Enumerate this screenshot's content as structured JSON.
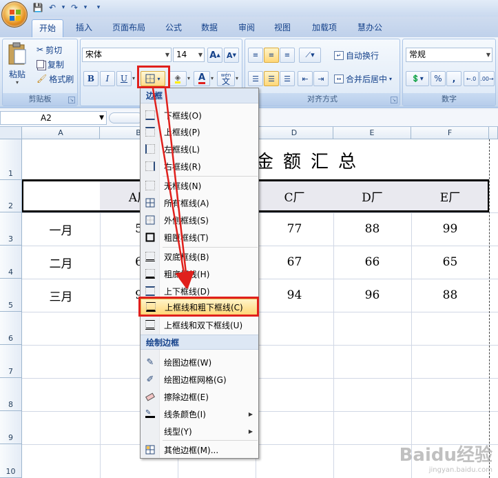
{
  "qat": {
    "save": "💾",
    "undo": "↶",
    "redo": "↷",
    "more": "▾"
  },
  "tabs": [
    "开始",
    "插入",
    "页面布局",
    "公式",
    "数据",
    "审阅",
    "视图",
    "加载项",
    "慧办公"
  ],
  "clipboard": {
    "label": "剪贴板",
    "paste": "粘贴",
    "cut": "剪切",
    "copy": "复制",
    "format_painter": "格式刷"
  },
  "font": {
    "name": "宋体",
    "size": "14",
    "bold": "B",
    "italic": "I",
    "underline": "U",
    "grow": "A",
    "shrink": "A",
    "wen": "wén",
    "wen_char": "文",
    "font_color": "A"
  },
  "alignment": {
    "label": "对齐方式",
    "wrap": "自动换行",
    "merge": "合并后居中"
  },
  "number": {
    "label": "数字",
    "format": "常规",
    "percent": "%",
    "comma": ","
  },
  "formula": {
    "name_box": "A2"
  },
  "columns": [
    "A",
    "B",
    "C",
    "D",
    "E",
    "F"
  ],
  "rows": [
    "1",
    "2",
    "3",
    "4",
    "5",
    "6",
    "7",
    "8",
    "9",
    "10"
  ],
  "sheet": {
    "title": "金额汇总",
    "headers": [
      "A厂",
      "C厂",
      "D厂",
      "E厂"
    ],
    "row_labels": [
      "一月",
      "二月",
      "三月"
    ],
    "b_partial": [
      "5",
      "6",
      "9"
    ],
    "values": [
      [
        "77",
        "88",
        "99"
      ],
      [
        "67",
        "66",
        "65"
      ],
      [
        "94",
        "96",
        "88"
      ]
    ]
  },
  "menu": {
    "header_border": "边框",
    "items_a": [
      "下框线(O)",
      "上框线(P)",
      "左框线(L)",
      "右框线(R)"
    ],
    "items_b": [
      "无框线(N)",
      "所有框线(A)",
      "外侧框线(S)",
      "粗匣框线(T)"
    ],
    "items_c": [
      "双底框线(B)",
      "粗底框线(H)",
      "上下框线(D)",
      "上框线和粗下框线(C)",
      "上框线和双下框线(U)"
    ],
    "header_draw": "绘制边框",
    "items_d": [
      "绘图边框(W)",
      "绘图边框网格(G)",
      "擦除边框(E)",
      "线条颜色(I)",
      "线型(Y)"
    ],
    "other": "其他边框(M)..."
  },
  "watermark": {
    "main": "Baidu经验",
    "sub": "jingyan.baidu.com"
  },
  "colors": {
    "accent_red": "#e0201c",
    "ribbon_blue": "#15428b",
    "highlight": "#ffd778"
  }
}
